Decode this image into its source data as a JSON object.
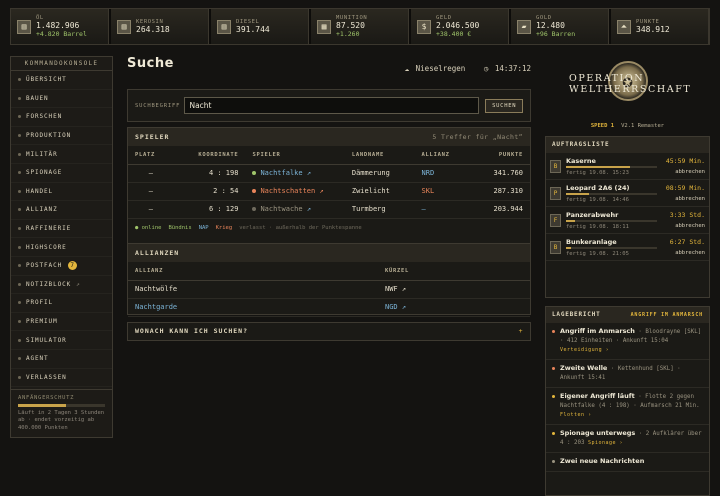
{
  "resources": [
    {
      "label": "Öl",
      "value": "1.482.906",
      "delta": "+4.820 Barrel",
      "icon": "oil-barrel-icon",
      "sym": "▥"
    },
    {
      "label": "Kerosin",
      "value": "264.318",
      "delta": "",
      "icon": "kerosene-barrel-icon",
      "sym": "▥"
    },
    {
      "label": "Diesel",
      "value": "391.744",
      "delta": "",
      "icon": "diesel-barrel-icon",
      "sym": "▥"
    },
    {
      "label": "Munition",
      "value": "87.520",
      "delta": "+1.260",
      "icon": "ammo-crate-icon",
      "sym": "▦"
    },
    {
      "label": "Geld",
      "value": "2.046.500",
      "delta": "+38.400 €",
      "icon": "money-icon",
      "sym": "$"
    },
    {
      "label": "Gold",
      "value": "12.480",
      "delta": "+96 Barren",
      "icon": "gold-bar-icon",
      "sym": "▰"
    },
    {
      "label": "Punkte",
      "value": "348.912",
      "delta": "",
      "icon": "points-chevron-icon",
      "sym": "⏶"
    }
  ],
  "sidebar": {
    "title": "Kommandokonsole",
    "items": [
      {
        "label": "Übersicht"
      },
      {
        "label": "Bauen"
      },
      {
        "label": "Forschen"
      },
      {
        "label": "Produktion"
      },
      {
        "label": "Militär"
      },
      {
        "label": "Spionage"
      },
      {
        "label": "Handel"
      },
      {
        "label": "Allianz"
      },
      {
        "label": "Raffinerie"
      },
      {
        "label": "Highscore"
      },
      {
        "label": "Postfach",
        "badge": "7"
      },
      {
        "label": "Notizblock",
        "ext": "↗"
      },
      {
        "label": "Profil"
      },
      {
        "label": "Premium"
      },
      {
        "label": "Simulator"
      },
      {
        "label": "Agent"
      },
      {
        "label": "Verlassen"
      }
    ],
    "protection": {
      "title": "Anfängerschutz",
      "text": "Läuft in 2 Tagen 3 Stunden ab · endet vorzeitig ab 400.000 Punkten",
      "progress": 0.55
    }
  },
  "main": {
    "title": "Suche",
    "weather": "Nieselregen",
    "time": "14:37:12",
    "search": {
      "label": "Suchbegriff",
      "value": "Nacht",
      "button": "Suchen"
    },
    "players": {
      "title": "Spieler",
      "hits": "5 Treffer für „Nacht“",
      "headers": [
        "Platz",
        "Koordinate",
        "Spieler",
        "Landname",
        "Allianz",
        "Punkte"
      ],
      "rows": [
        {
          "rank": "–",
          "coord": "4 : 198",
          "player": "Nachtfalke",
          "land": "Dämmerung",
          "ally": "NRD",
          "points": "341.760",
          "status": "online"
        },
        {
          "rank": "–",
          "coord": "2 : 54",
          "player": "Nachtschatten",
          "land": "Zwielicht",
          "ally": "SKL",
          "points": "287.310",
          "status": "krieg"
        },
        {
          "rank": "–",
          "coord": "6 : 129",
          "player": "Nachtwache",
          "land": "Turmberg",
          "ally": "–",
          "points": "203.944",
          "status": "neutral"
        }
      ],
      "legend": {
        "online": "online",
        "buendnis": "Bündnis",
        "nap": "NAP",
        "krieg": "Krieg",
        "verlasst": "verlasst · außerhalb der Punktespanne"
      }
    },
    "allies": {
      "title": "Allianzen",
      "headers": [
        "Allianz",
        "Kürzel"
      ],
      "rows": [
        {
          "name": "Nachtwölfe",
          "tag": "NWF"
        },
        {
          "name": "Nachtgarde",
          "tag": "NGD"
        }
      ]
    },
    "faq": {
      "title": "Wonach kann ich suchen?",
      "toggle": "+"
    }
  },
  "right": {
    "logo": {
      "name": "Operation Weltherrschaft",
      "speed": "SPEED 1",
      "version": "V2.1 Remaster"
    },
    "orders": {
      "title": "Auftragsliste",
      "items": [
        {
          "code": "B",
          "name": "Kaserne",
          "time": "45:59 Min.",
          "done": "fertig 19.08. 15:23",
          "action": "abbrechen",
          "progress": 0.7
        },
        {
          "code": "P",
          "name": "Leopard 2A6 (24)",
          "time": "08:59 Min.",
          "done": "fertig 19.08. 14:46",
          "action": "abbrechen",
          "progress": 0.25
        },
        {
          "code": "F",
          "name": "Panzerabwehr",
          "time": "3:33 Std.",
          "done": "fertig 19.08. 18:11",
          "action": "abbrechen",
          "progress": 0.1
        },
        {
          "code": "B",
          "name": "Bunkeranlage",
          "time": "6:27 Std.",
          "done": "fertig 19.08. 21:05",
          "action": "abbrechen",
          "progress": 0.05
        }
      ]
    },
    "report": {
      "title": "Lagebericht",
      "alert": "Angriff im Anmarsch",
      "events": [
        {
          "head": "Angriff im Anmarsch",
          "text": "· Bloodrayne [SKL] · 412 Einheiten · Ankunft 15:04",
          "link": "Verteidigung ›",
          "color": "#e8845a"
        },
        {
          "head": "Zweite Welle",
          "text": "· Kettenhund [SKL] · Ankunft 15:41",
          "link": "",
          "color": "#e8845a"
        },
        {
          "head": "Eigener Angriff läuft",
          "text": "· Flotte 2 gegen Nachtfalke (4 : 198) · Aufmarsch 21 Min.",
          "link": "Flotten ›",
          "color": "#e3b63c"
        },
        {
          "head": "Spionage unterwegs",
          "text": "· 2 Aufklärer über 4 : 203",
          "link": "Spionage ›",
          "color": "#e3b63c"
        },
        {
          "head": "Zwei neue Nachrichten",
          "text": "",
          "link": "",
          "color": "#9a9380"
        }
      ]
    }
  }
}
